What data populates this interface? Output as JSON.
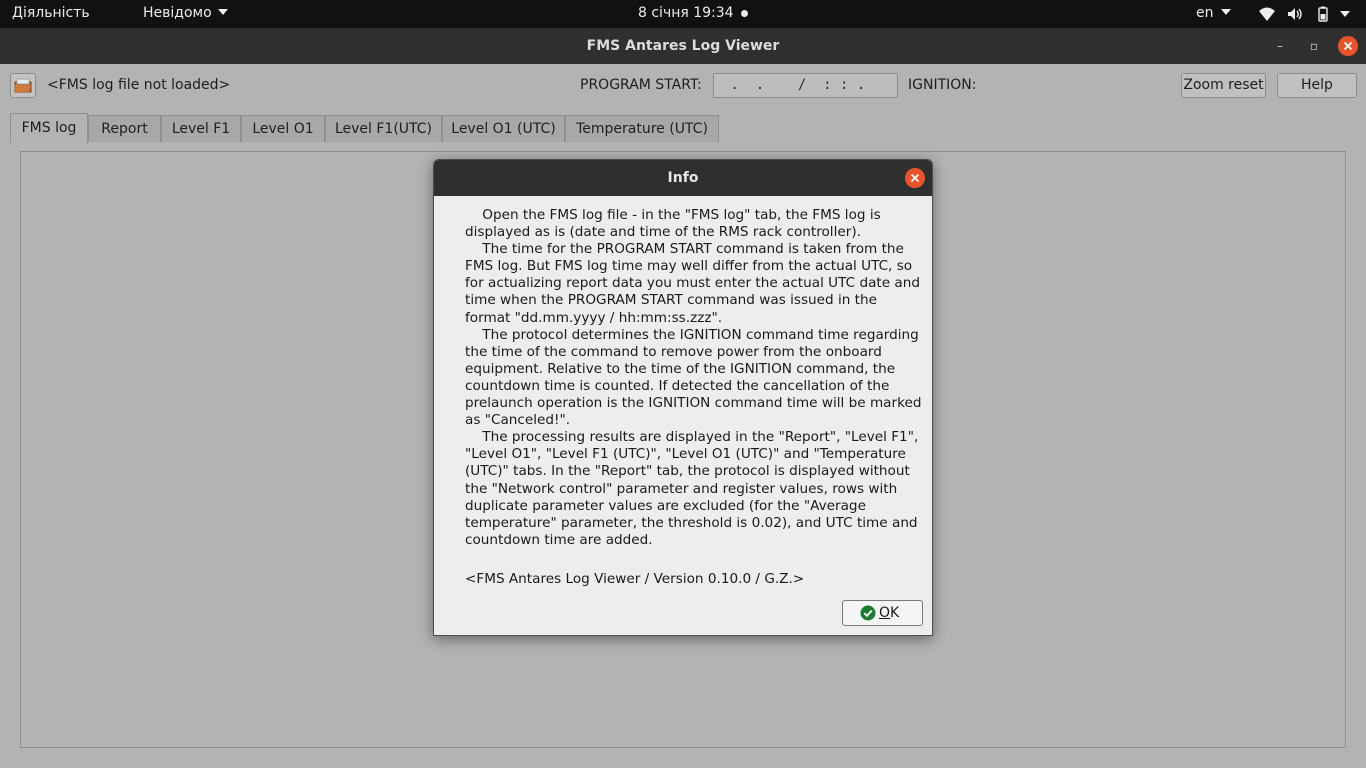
{
  "topbar": {
    "activities": "Діяльність",
    "app_menu": "Невідомо",
    "clock": "8 січня  19:34",
    "language": "en",
    "icons": [
      "wifi-icon",
      "volume-icon",
      "battery-icon",
      "chevron-down-icon"
    ]
  },
  "window": {
    "title": "FMS Antares Log Viewer",
    "controls": [
      "minimize-icon",
      "maximize-icon",
      "close-icon"
    ]
  },
  "toolbar": {
    "open_icon": "folder-open-icon",
    "file_label": "<FMS log file not loaded>",
    "program_start_label": "PROGRAM START:",
    "program_start_value": " .  .    /  : : .",
    "ignition_label": "IGNITION:",
    "zoom_reset_label": "Zoom reset",
    "help_label": "Help"
  },
  "tabs": [
    {
      "label": "FMS log",
      "active": true
    },
    {
      "label": "Report",
      "active": false
    },
    {
      "label": "Level F1",
      "active": false
    },
    {
      "label": "Level O1",
      "active": false
    },
    {
      "label": "Level F1(UTC)",
      "active": false
    },
    {
      "label": "Level O1 (UTC)",
      "active": false
    },
    {
      "label": "Temperature (UTC)",
      "active": false
    }
  ],
  "dialog": {
    "title": "Info",
    "paragraphs": [
      "Open the FMS log file - in the \"FMS log\" tab, the FMS log is displayed as is (date and time of the RMS rack controller).",
      "The time for the PROGRAM START command is taken from the FMS log. But FMS log time may well differ from the actual UTC, so for actualizing report data you must enter the actual UTC date and time when the PROGRAM START command was issued in the format \"dd.mm.yyyy / hh:mm:ss.zzz\".",
      "The protocol determines the IGNITION command time regarding the time of the command to remove power from the onboard equipment. Relative to the time of the IGNITION command, the countdown time is counted. If detected the cancellation of the prelaunch operation is the IGNITION command time will be marked as \"Canceled!\".",
      "The processing results are displayed in the \"Report\", \"Level F1\", \"Level O1\", \"Level F1 (UTC)\", \"Level O1 (UTC)\" and \"Temperature (UTC)\" tabs. In the \"Report\" tab, the protocol is displayed without the \"Network control\" parameter and register values, rows with duplicate parameter values are excluded (for the \"Average temperature\" parameter, the threshold is 0.02), and UTC time and countdown time are added."
    ],
    "version": "<FMS Antares Log Viewer / Version 0.10.0 / G.Z.>",
    "ok_label": "OK",
    "ok_icon": "check-circle-icon"
  },
  "colors": {
    "close_button": "#e6542b",
    "ok_check": "#1e7a2e",
    "topbar": "#111111",
    "titlebar": "#2f2f2f"
  }
}
